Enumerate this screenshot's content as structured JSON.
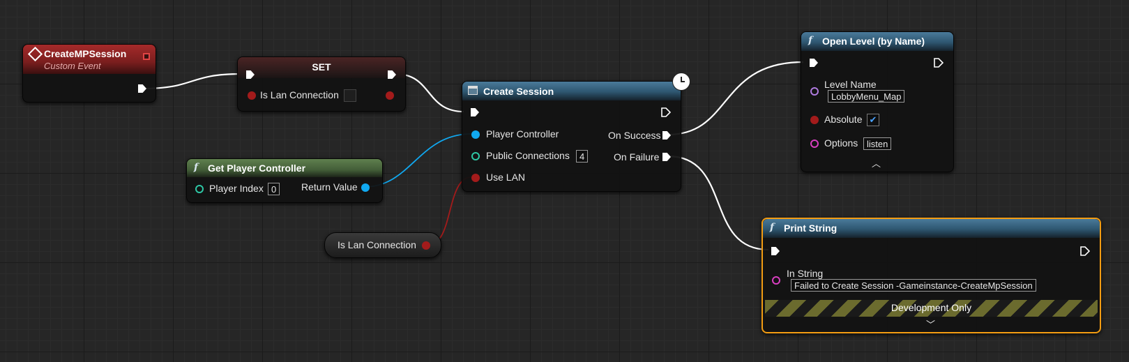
{
  "nodes": {
    "custom_event": {
      "title": "CreateMPSession",
      "subtitle": "Custom Event"
    },
    "set_node": {
      "title": "SET",
      "pin_label": "Is Lan Connection",
      "checked": false
    },
    "get_player_controller": {
      "title": "Get Player Controller",
      "player_index_label": "Player Index",
      "player_index_value": "0",
      "return_label": "Return Value"
    },
    "is_lan_getter": {
      "label": "Is Lan Connection"
    },
    "create_session": {
      "title": "Create Session",
      "player_controller_label": "Player Controller",
      "public_connections_label": "Public Connections",
      "public_connections_value": "4",
      "use_lan_label": "Use LAN",
      "on_success_label": "On Success",
      "on_failure_label": "On Failure"
    },
    "open_level": {
      "title": "Open Level (by Name)",
      "level_name_label": "Level Name",
      "level_name_value": "LobbyMenu_Map",
      "absolute_label": "Absolute",
      "absolute_checked": true,
      "options_label": "Options",
      "options_value": "listen"
    },
    "print_string": {
      "title": "Print String",
      "in_string_label": "In String",
      "in_string_value": "Failed to Create Session -Gameinstance-CreateMpSession",
      "dev_only_label": "Development Only"
    }
  },
  "icons": {
    "function": "f",
    "event": "diamond-event-icon",
    "latent": "clock-icon",
    "collapse": "chevron-up-icon",
    "expand": "chevron-down-icon"
  },
  "colors": {
    "exec": "#ffffff",
    "object_pin": "#10a8f0",
    "int_pin": "#2ec7a5",
    "bool_pin": "#a31b1b",
    "string_pin": "#d93ec0",
    "name_pin": "#b07be0",
    "selection": "#f39c12"
  }
}
